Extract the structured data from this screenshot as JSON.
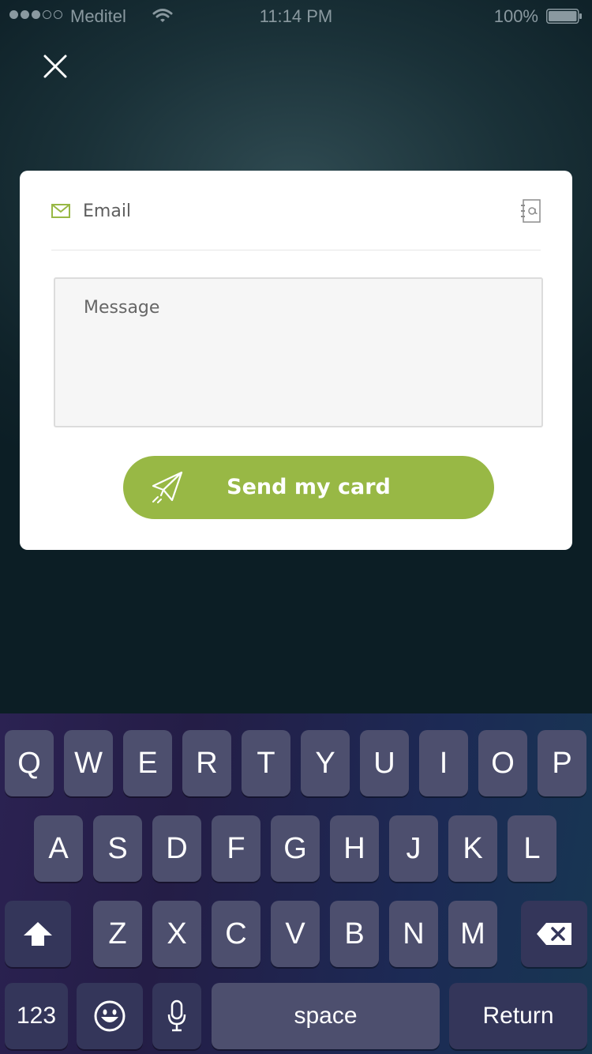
{
  "status_bar": {
    "carrier": "Meditel",
    "time": "11:14 PM",
    "battery": "100%",
    "signal_bars": 3,
    "signal_total": 5
  },
  "icons": {
    "close": "close-icon",
    "mail": "mail-icon",
    "contacts": "address-book-icon",
    "send": "paper-plane-icon",
    "shift": "shift-icon",
    "backspace": "backspace-icon",
    "emoji": "emoji-icon",
    "mic": "microphone-icon"
  },
  "form": {
    "email_placeholder": "Email",
    "email_value": "",
    "message_placeholder": "Message",
    "message_value": "",
    "send_label": "Send my card"
  },
  "colors": {
    "accent": "#98b845",
    "background": "#1a3138",
    "card": "#ffffff",
    "key": "#4d4f6e"
  },
  "keyboard": {
    "row1": [
      "Q",
      "W",
      "E",
      "R",
      "T",
      "Y",
      "U",
      "I",
      "O",
      "P"
    ],
    "row2": [
      "A",
      "S",
      "D",
      "F",
      "G",
      "H",
      "J",
      "K",
      "L"
    ],
    "row3": [
      "Z",
      "X",
      "C",
      "V",
      "B",
      "N",
      "M"
    ],
    "numbers_label": "123",
    "space_label": "space",
    "return_label": "Return"
  }
}
